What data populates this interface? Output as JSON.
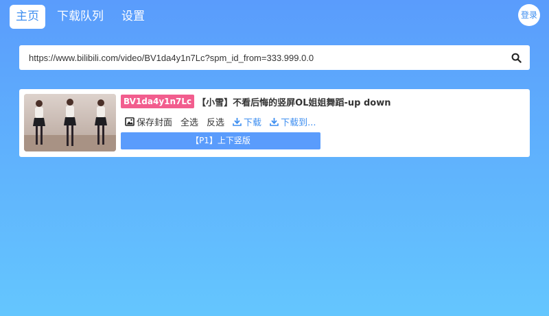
{
  "nav": {
    "items": [
      {
        "label": "主页",
        "active": true
      },
      {
        "label": "下载队列",
        "active": false
      },
      {
        "label": "设置",
        "active": false
      }
    ],
    "login_label": "登录"
  },
  "search": {
    "value": "https://www.bilibili.com/video/BV1da4y1n7Lc?spm_id_from=333.999.0.0",
    "icon": "search-icon"
  },
  "video": {
    "bv": "BV1da4y1n7Lc",
    "title": "【小雪】不看后悔的竖屏OL姐姐舞蹈-up down",
    "actions": {
      "save_cover": "保存封面",
      "select_all": "全选",
      "invert": "反选",
      "download": "下载",
      "download_to": "下载到..."
    },
    "parts": [
      {
        "label": "【P1】上下竖版"
      }
    ]
  },
  "colors": {
    "accent": "#3d8ef0",
    "badge": "#f25d8e",
    "gradient_top": "#5a9cfc",
    "gradient_bottom": "#64c6fe"
  }
}
